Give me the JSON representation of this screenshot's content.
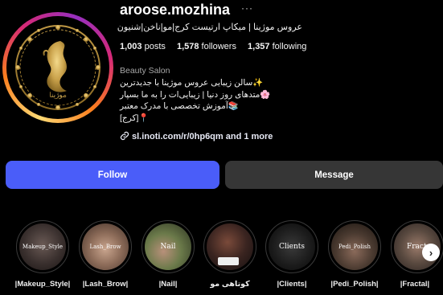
{
  "profile": {
    "username": "aroose.mozhina",
    "tagline": "عروس موژینا | میکاپ ارتیست کرج|مو|ناخن|شنیون",
    "category": "Beauty Salon",
    "link": "sl.inoti.com/r/0hp6qm and 1 more",
    "avatar_logo_text": "موژینا"
  },
  "stats": {
    "posts": {
      "count": "1,003",
      "label": "posts"
    },
    "followers": {
      "count": "1,578",
      "label": "followers"
    },
    "following": {
      "count": "1,357",
      "label": "following"
    }
  },
  "bio": {
    "line1": "✨سالن زیبایی عروس موژینا با جدیدترین",
    "line2": "🌸متدهای روز دنیا | زیبایی‌ات را به ما بسپار",
    "line3": "📚آموزش تخصصی با مدرک معتبر",
    "line4": "📍[کرج]"
  },
  "actions": {
    "follow": "Follow",
    "message": "Message"
  },
  "highlights": [
    {
      "label": "|Makeup_Style|",
      "cover": "Makeup_Style"
    },
    {
      "label": "|Lash_Brow|",
      "cover": "Lash_Brow"
    },
    {
      "label": "|Nail|",
      "cover": "Nail"
    },
    {
      "label": "کوتاهی مو",
      "cover": ""
    },
    {
      "label": "|Clients|",
      "cover": "Clients"
    },
    {
      "label": "|Pedi_Polish|",
      "cover": "Pedi_Polish"
    },
    {
      "label": "|Fractal|",
      "cover": "Fract"
    }
  ],
  "colors": {
    "follow_button": "#4a5df9",
    "message_button": "#363636",
    "background": "#000000"
  },
  "icons": {
    "more": "ellipsis-icon",
    "link": "link-icon",
    "next": "chevron-right-icon"
  }
}
